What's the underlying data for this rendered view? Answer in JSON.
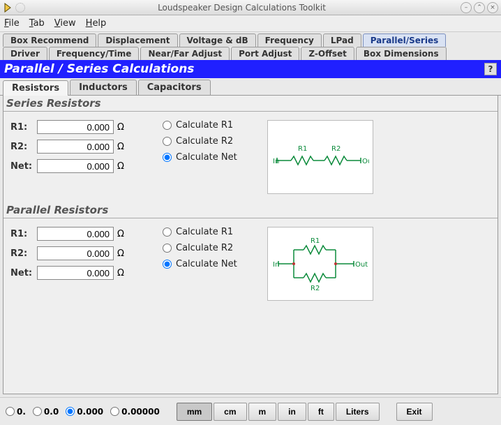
{
  "window": {
    "title": "Loudspeaker Design Calculations Toolkit"
  },
  "menu": {
    "file": "File",
    "tab": "Tab",
    "view": "View",
    "help": "Help"
  },
  "tabs": {
    "row1": [
      "Box Recommend",
      "Displacement",
      "Voltage & dB",
      "Frequency",
      "LPad",
      "Parallel/Series"
    ],
    "row2": [
      "Driver",
      "Frequency/Time",
      "Near/Far Adjust",
      "Port Adjust",
      "Z-Offset",
      "Box Dimensions"
    ],
    "active": "Parallel/Series"
  },
  "section": {
    "title": "Parallel / Series Calculations",
    "help": "?"
  },
  "subtabs": {
    "items": [
      "Resistors",
      "Inductors",
      "Capacitors"
    ],
    "active": "Resistors"
  },
  "series": {
    "title": "Series Resistors",
    "r1_label": "R1:",
    "r1_value": "0.000",
    "r2_label": "R2:",
    "r2_value": "0.000",
    "net_label": "Net:",
    "net_value": "0.000",
    "unit": "Ω",
    "calc_r1": "Calculate R1",
    "calc_r2": "Calculate R2",
    "calc_net": "Calculate Net",
    "selected": "net",
    "diag": {
      "in": "In",
      "out": "Out",
      "r1": "R1",
      "r2": "R2"
    }
  },
  "parallel": {
    "title": "Parallel Resistors",
    "r1_label": "R1:",
    "r1_value": "0.000",
    "r2_label": "R2:",
    "r2_value": "0.000",
    "net_label": "Net:",
    "net_value": "0.000",
    "unit": "Ω",
    "calc_r1": "Calculate R1",
    "calc_r2": "Calculate R2",
    "calc_net": "Calculate Net",
    "selected": "net",
    "diag": {
      "in": "In",
      "out": "Out",
      "r1": "R1",
      "r2": "R2"
    }
  },
  "bottom": {
    "precision": {
      "p0": "0.",
      "p1": "0.0",
      "p2": "0.000",
      "p3": "0.00000",
      "selected": "p2"
    },
    "units": {
      "mm": "mm",
      "cm": "cm",
      "m": "m",
      "in": "in",
      "ft": "ft",
      "liters": "Liters",
      "selected": "mm"
    },
    "exit": "Exit"
  }
}
